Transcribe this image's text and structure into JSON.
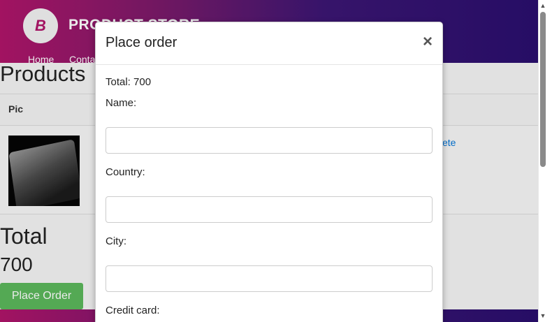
{
  "navbar": {
    "logo_letter": "B",
    "brand": "PRODUCT STORE",
    "links": [
      "Home",
      "Contact"
    ]
  },
  "cart": {
    "title": "Products",
    "columns": [
      "Pic"
    ],
    "rows": [
      {
        "image": "laptop-image",
        "action": "Delete"
      }
    ],
    "total_title": "Total",
    "total_value": "700",
    "place_order_label": "Place Order"
  },
  "modal": {
    "title": "Place order",
    "close_symbol": "×",
    "total_line": "Total: 700",
    "fields": [
      {
        "label": "Name:",
        "value": ""
      },
      {
        "label": "Country:",
        "value": ""
      },
      {
        "label": "City:",
        "value": ""
      },
      {
        "label": "Credit card:",
        "value": ""
      }
    ]
  },
  "scrollbar": {
    "up_icon": "scroll-up-arrow-icon",
    "down_icon": "scroll-down-arrow-icon"
  },
  "colors": {
    "brand_magenta": "#b0156a",
    "brand_purple": "#2a0f6e",
    "button_green": "#5cb85c",
    "link_blue": "#0275d8"
  }
}
